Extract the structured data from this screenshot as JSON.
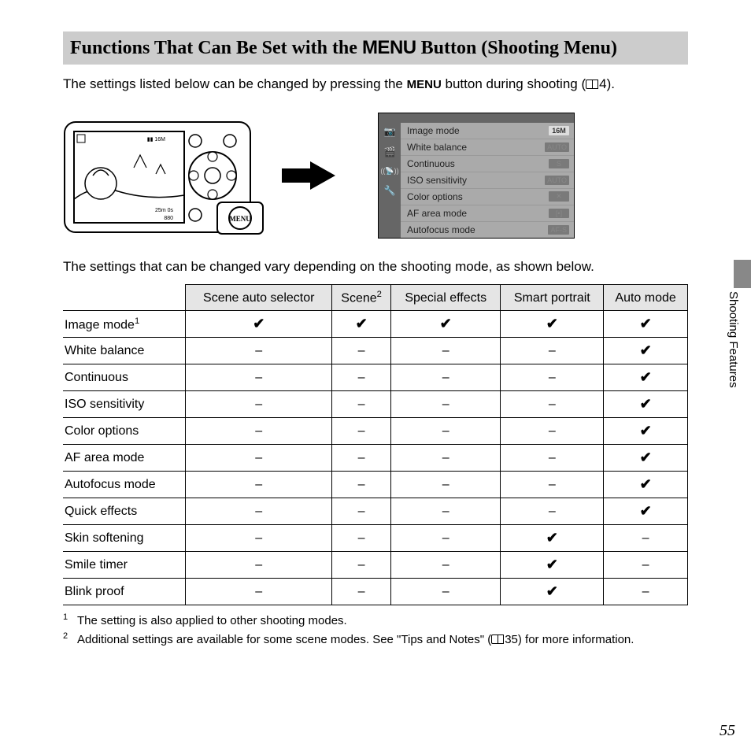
{
  "title": {
    "pre": "Functions That Can Be Set with the ",
    "menu": "MENU",
    "post": " Button (Shooting Menu)"
  },
  "intro": {
    "pre": "The settings listed below can be changed by pressing the ",
    "menu": "MENU",
    "post": " button during shooting (",
    "ref": "4",
    "close": ")."
  },
  "camera_menu_caption": "MENU",
  "menu_items": [
    {
      "label": "Image mode",
      "value": "16M"
    },
    {
      "label": "White balance",
      "value": "AUTO"
    },
    {
      "label": "Continuous",
      "value": "S"
    },
    {
      "label": "ISO sensitivity",
      "value": "AUTO"
    },
    {
      "label": "Color options",
      "value": "✕"
    },
    {
      "label": "AF area mode",
      "value": "[•]"
    },
    {
      "label": "Autofocus mode",
      "value": "AF-S"
    }
  ],
  "menu_icons": [
    "📷",
    "🎬",
    "((📡))",
    "🔧"
  ],
  "below_text": "The settings that can be changed vary depending on the shooting mode, as shown below.",
  "table": {
    "headers": [
      "",
      "Scene auto selector",
      "Scene",
      "Special effects",
      "Smart portrait",
      "Auto mode"
    ],
    "header_sup": {
      "1": "",
      "2": "2"
    },
    "rows": [
      {
        "label": "Image mode",
        "sup": "1",
        "cells": [
          "✔",
          "✔",
          "✔",
          "✔",
          "✔"
        ]
      },
      {
        "label": "White balance",
        "sup": "",
        "cells": [
          "–",
          "–",
          "–",
          "–",
          "✔"
        ]
      },
      {
        "label": "Continuous",
        "sup": "",
        "cells": [
          "–",
          "–",
          "–",
          "–",
          "✔"
        ]
      },
      {
        "label": "ISO sensitivity",
        "sup": "",
        "cells": [
          "–",
          "–",
          "–",
          "–",
          "✔"
        ]
      },
      {
        "label": "Color options",
        "sup": "",
        "cells": [
          "–",
          "–",
          "–",
          "–",
          "✔"
        ]
      },
      {
        "label": "AF area mode",
        "sup": "",
        "cells": [
          "–",
          "–",
          "–",
          "–",
          "✔"
        ]
      },
      {
        "label": "Autofocus mode",
        "sup": "",
        "cells": [
          "–",
          "–",
          "–",
          "–",
          "✔"
        ]
      },
      {
        "label": "Quick effects",
        "sup": "",
        "cells": [
          "–",
          "–",
          "–",
          "–",
          "✔"
        ]
      },
      {
        "label": "Skin softening",
        "sup": "",
        "cells": [
          "–",
          "–",
          "–",
          "✔",
          "–"
        ]
      },
      {
        "label": "Smile timer",
        "sup": "",
        "cells": [
          "–",
          "–",
          "–",
          "✔",
          "–"
        ]
      },
      {
        "label": "Blink proof",
        "sup": "",
        "cells": [
          "–",
          "–",
          "–",
          "✔",
          "–"
        ]
      }
    ]
  },
  "footnotes": [
    {
      "num": "1",
      "text": "The setting is also applied to other shooting modes."
    },
    {
      "num": "2",
      "text_pre": "Additional settings are available for some scene modes. See \"Tips and Notes\" (",
      "ref": "35",
      "text_post": ") for more information."
    }
  ],
  "side_tab": "Shooting Features",
  "page_number": "55"
}
